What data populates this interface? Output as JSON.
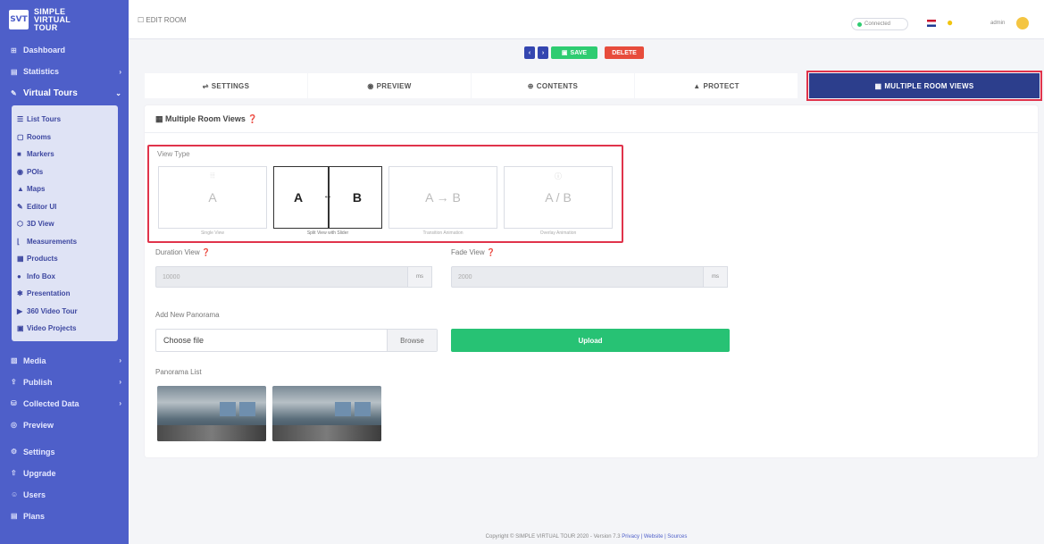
{
  "app": {
    "brand_lines": [
      "SIMPLE",
      "VIRTUAL",
      "TOUR"
    ],
    "brand_logo": "SVT"
  },
  "sidebar": {
    "items_top": [
      {
        "label": "Dashboard",
        "icon": "dashboard-icon",
        "chevron": false
      },
      {
        "label": "Statistics",
        "icon": "chart-icon",
        "chevron": true
      }
    ],
    "active": {
      "label": "Virtual Tours",
      "icon": "tours-icon"
    },
    "submenu": [
      {
        "label": "List Tours",
        "icon": "list-icon"
      },
      {
        "label": "Rooms",
        "icon": "room-icon"
      },
      {
        "label": "Markers",
        "icon": "marker-icon"
      },
      {
        "label": "POIs",
        "icon": "poi-icon"
      },
      {
        "label": "Maps",
        "icon": "map-icon"
      },
      {
        "label": "Editor UI",
        "icon": "editor-icon"
      },
      {
        "label": "3D View",
        "icon": "3d-icon"
      },
      {
        "label": "Measurements",
        "icon": "ruler-icon"
      },
      {
        "label": "Products",
        "icon": "cart-icon"
      },
      {
        "label": "Info Box",
        "icon": "info-icon"
      },
      {
        "label": "Presentation",
        "icon": "presentation-icon"
      },
      {
        "label": "360 Video Tour",
        "icon": "video-icon"
      },
      {
        "label": "Video Projects",
        "icon": "film-icon"
      }
    ],
    "items_bottom": [
      {
        "label": "Media",
        "icon": "media-icon",
        "chevron": true
      },
      {
        "label": "Publish",
        "icon": "publish-icon",
        "chevron": true
      },
      {
        "label": "Collected Data",
        "icon": "data-icon",
        "chevron": true
      },
      {
        "label": "Preview",
        "icon": "eye-icon",
        "chevron": false
      },
      {
        "label": "Settings",
        "icon": "gear-icon",
        "chevron": false
      },
      {
        "label": "Upgrade",
        "icon": "upgrade-icon",
        "chevron": false
      },
      {
        "label": "Users",
        "icon": "users-icon",
        "chevron": false
      },
      {
        "label": "Plans",
        "icon": "plans-icon",
        "chevron": false
      }
    ]
  },
  "topbar": {
    "breadcrumb": "EDIT ROOM",
    "status": "Connected",
    "user": "admin"
  },
  "actions": {
    "prev": "‹",
    "next": "›",
    "save": "SAVE",
    "delete": "DELETE"
  },
  "tabs": [
    {
      "label": "SETTINGS",
      "icon": "sliders-icon"
    },
    {
      "label": "PREVIEW",
      "icon": "eye-icon"
    },
    {
      "label": "CONTENTS",
      "icon": "globe-icon"
    },
    {
      "label": "PROTECT",
      "icon": "lock-icon"
    },
    {
      "label": "MULTIPLE ROOM VIEWS",
      "icon": "grid-icon",
      "active": true
    }
  ],
  "card": {
    "title": "Multiple Room Views",
    "view_type": {
      "label": "View Type",
      "options": [
        {
          "text": "A",
          "caption": "Single View",
          "selected": false
        },
        {
          "text_a": "A",
          "text_b": "B",
          "caption": "Split View with Slider",
          "selected": true
        },
        {
          "text": "A → B",
          "caption": "Transition Animation",
          "selected": false
        },
        {
          "text": "A / B",
          "caption": "Overlay Animation",
          "selected": false
        }
      ]
    },
    "duration": {
      "label": "Duration View",
      "value": "10000",
      "unit": "ms"
    },
    "fade": {
      "label": "Fade View",
      "value": "2000",
      "unit": "ms"
    },
    "add_panorama": {
      "label": "Add New Panorama",
      "file_placeholder": "Choose file",
      "browse": "Browse",
      "upload": "Upload"
    },
    "panorama_list": {
      "label": "Panorama List"
    }
  },
  "footer": {
    "copyright": "Copyright © SIMPLE VIRTUAL TOUR 2020 - Version 7.3",
    "links": "Privacy | Website | Sources"
  },
  "colors": {
    "sidebar": "#4e5fc9",
    "accent_tab": "#2c3e8c",
    "highlight": "#e0334b",
    "success": "#27c274",
    "danger": "#e74c3c"
  }
}
